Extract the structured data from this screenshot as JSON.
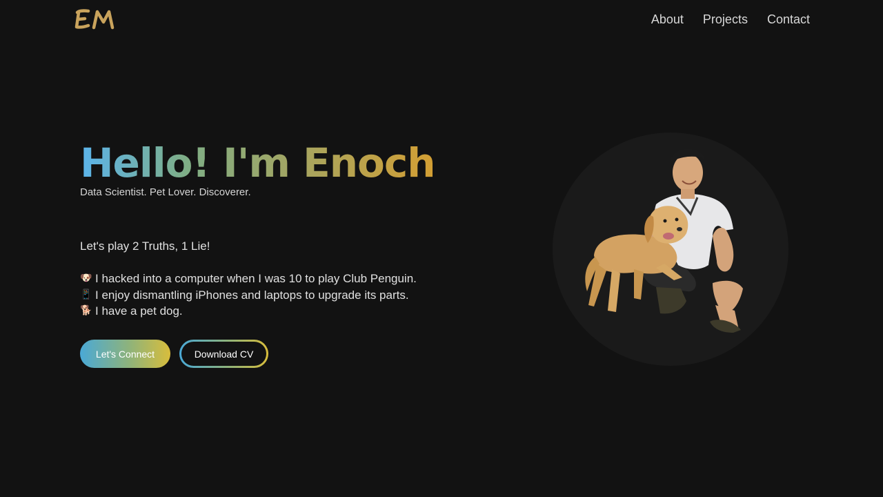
{
  "header": {
    "logo_text": "EM",
    "nav": [
      {
        "label": "About"
      },
      {
        "label": "Projects"
      },
      {
        "label": "Contact"
      }
    ]
  },
  "hero": {
    "title": "Hello! I'm Enoch",
    "subtitle": "Data Scientist. Pet Lover. Discoverer.",
    "intro": "Let's play 2 Truths, 1 Lie!",
    "facts": [
      {
        "emoji": "🐶",
        "text": "I hacked into a computer when I was 10 to play Club Penguin."
      },
      {
        "emoji": "📱",
        "text": "I enjoy dismantling iPhones and laptops to upgrade its parts."
      },
      {
        "emoji": "🐕",
        "text": "I have a pet dog."
      }
    ],
    "buttons": {
      "connect": "Let's Connect",
      "cv": "Download CV"
    }
  },
  "colors": {
    "background": "#121212",
    "gradient_start": "#5bb4ec",
    "gradient_end": "#d49f33",
    "logo_gold": "#c9a35c"
  }
}
